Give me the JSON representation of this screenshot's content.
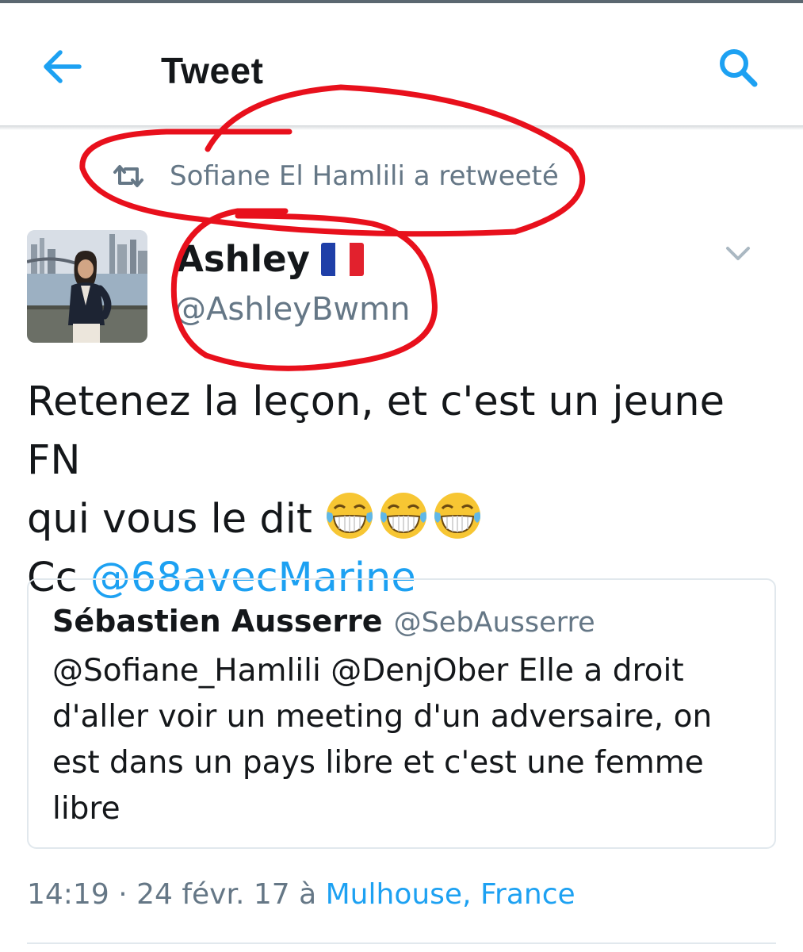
{
  "header": {
    "title": "Tweet",
    "back_icon": "arrow-left-icon",
    "search_icon": "search-icon",
    "accent_color": "#1da1f2"
  },
  "retweet": {
    "icon": "retweet-icon",
    "text": "Sofiane El Hamlili a retweeté"
  },
  "tweet": {
    "author_name": "Ashley",
    "author_flag": "🇫🇷",
    "author_handle": "@AshleyBwmn",
    "text_line1": "Retenez la leçon, et c'est un jeune FN",
    "text_line2": "qui vous le dit",
    "emoji": "😂😂😂",
    "text_line3_prefix": "Cc",
    "mention": "@68avecMarine",
    "timestamp": "14:19 · 24 févr. 17",
    "location_prefix": "à",
    "location": "Mulhouse, France"
  },
  "quoted_tweet": {
    "name": "Sébastien Ausserre",
    "handle": "@SebAusserre",
    "text": "@Sofiane_Hamlili @DenjOber Elle a droit d'aller voir un meeting d'un adversaire, on est dans un pays libre et c'est une femme libre"
  },
  "colors": {
    "annotation_red": "#e8101c",
    "muted_text": "#657786"
  }
}
